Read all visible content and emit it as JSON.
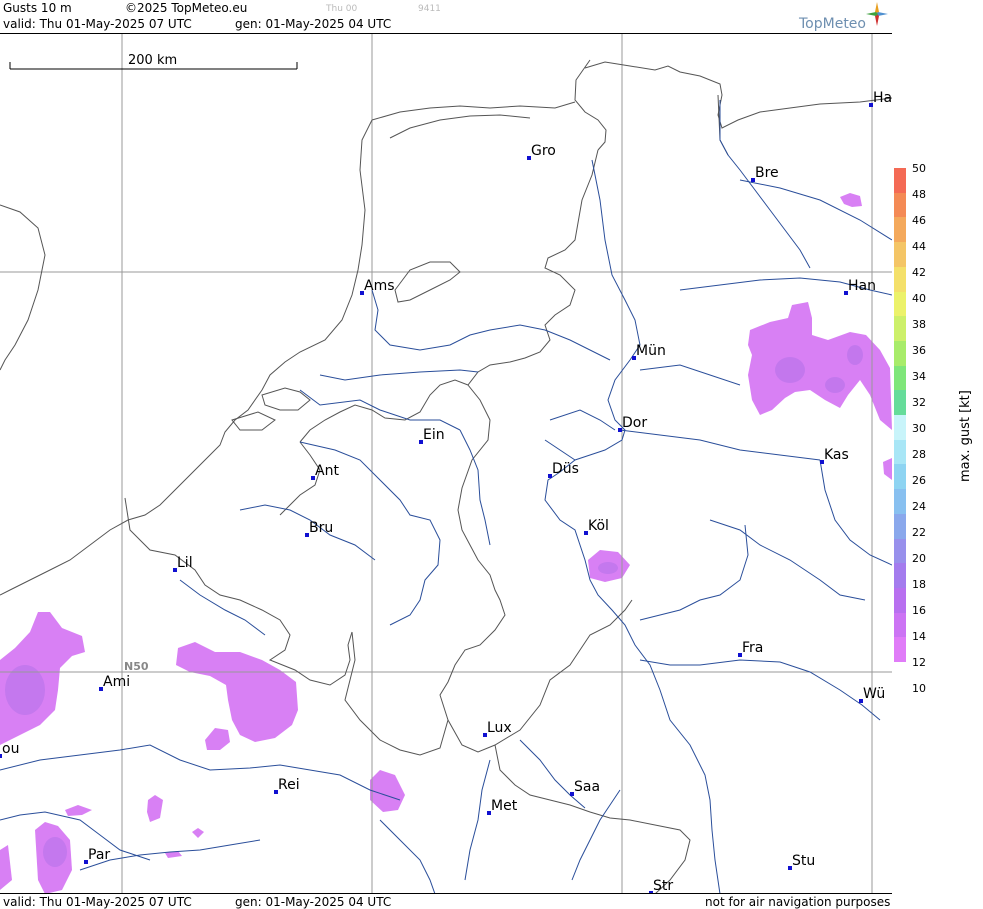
{
  "header": {
    "product": "Gusts 10 m",
    "copyright": "©2025 TopMeteo.eu",
    "valid": "valid:  Thu  01-May-2025  07 UTC",
    "gen": "gen: 01-May-2025 04 UTC",
    "faint1": "Thu 00",
    "faint2": "9411",
    "logo": "TopMeteo"
  },
  "scale_bar": {
    "label": "200 km"
  },
  "grid_label": "N50",
  "cities": [
    {
      "name": "Gro"
    },
    {
      "name": "Bre"
    },
    {
      "name": "Ha"
    },
    {
      "name": "Ams"
    },
    {
      "name": "Han"
    },
    {
      "name": "Mün"
    },
    {
      "name": "Dor"
    },
    {
      "name": "Ein"
    },
    {
      "name": "Ant"
    },
    {
      "name": "Düs"
    },
    {
      "name": "Kas"
    },
    {
      "name": "Bru"
    },
    {
      "name": "Köl"
    },
    {
      "name": "Lil"
    },
    {
      "name": "Fra"
    },
    {
      "name": "Ami"
    },
    {
      "name": "Wü"
    },
    {
      "name": "Lux"
    },
    {
      "name": "Rei"
    },
    {
      "name": "Saa"
    },
    {
      "name": "Met"
    },
    {
      "name": "Stu"
    },
    {
      "name": "Par"
    },
    {
      "name": "Str"
    },
    {
      "name": "ou"
    }
  ],
  "legend": {
    "title": "max. gust [kt]",
    "ticks": [
      "50",
      "48",
      "46",
      "44",
      "42",
      "40",
      "38",
      "36",
      "34",
      "32",
      "30",
      "28",
      "26",
      "24",
      "22",
      "20",
      "18",
      "16",
      "14",
      "12",
      "10"
    ],
    "colors": [
      "#f46a55",
      "#f48a55",
      "#f4a95c",
      "#f4c566",
      "#f4e06a",
      "#ecf26a",
      "#cdf06a",
      "#a8ec6a",
      "#7fe67a",
      "#66dc9a",
      "#c8f4fa",
      "#a8e6f6",
      "#8ed4f2",
      "#88c0f0",
      "#8aa8ec",
      "#9890ec",
      "#a47cee",
      "#b870f0",
      "#cc74f4",
      "#e07cf8"
    ]
  },
  "footer": {
    "valid": "valid:  Thu  01-May-2025  07 UTC",
    "gen": "gen: 01-May-2025 04 UTC",
    "note": "not for air navigation purposes"
  }
}
